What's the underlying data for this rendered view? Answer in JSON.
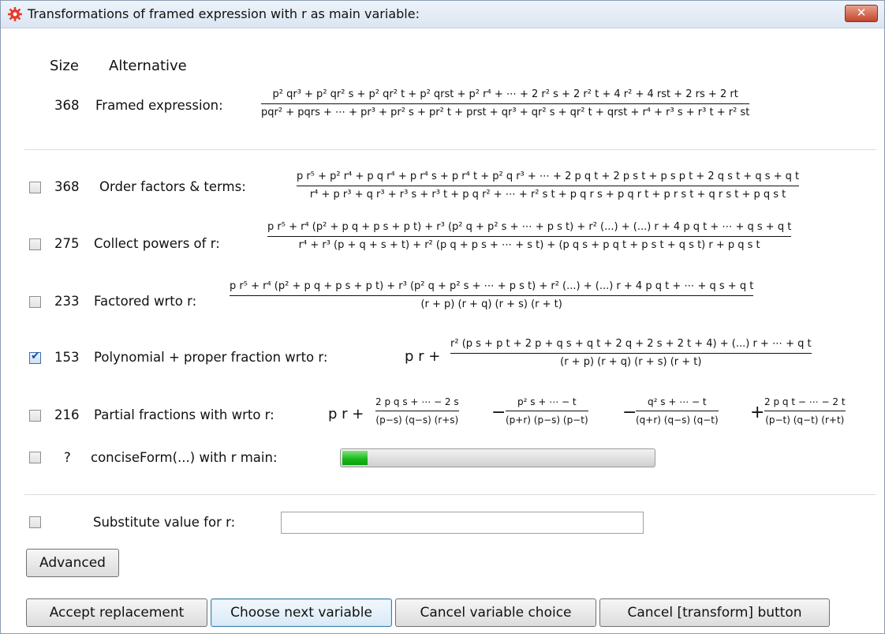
{
  "window": {
    "title": "Transformations of framed expression with r as main variable:",
    "close_label": "✕"
  },
  "header": {
    "size_col": "Size",
    "alt_col": "Alternative"
  },
  "framed": {
    "size": "368",
    "label": "Framed expression:",
    "num": "p² qr³ + p² qr² s + p² qr² t + p² qrst + p² r⁴ + ⋯ + 2 r² s + 2 r² t + 4 r² + 4 rst + 2 rs + 2 rt",
    "den": "pqr² + pqrs + ⋯ + pr³ + pr² s + pr² t + prst + qr³ + qr² s + qr² t + qrst + r⁴ + r³ s + r³ t + r² st"
  },
  "rows": [
    {
      "checked": false,
      "size": "368",
      "label": "Order factors & terms:",
      "num": "p r⁵ + p² r⁴ + p q r⁴ + p r⁴ s + p r⁴ t + p² q r³ + ⋯ + 2 p q t + 2 p s t + p s p t + 2 q s t + q s + q t",
      "den": "r⁴ + p r³ + q r³ + r³ s + r³ t + p q r² + ⋯ + r² s t + p q r s + p q r t + p r s t + q r s t + p q s t"
    },
    {
      "checked": false,
      "size": "275",
      "label": "Collect powers of r:",
      "num": "p r⁵ + r⁴ (p² + p q + p s + p t) + r³ (p² q + p² s + ⋯ + p s t) + r² (...) + (...) r + 4 p q t + ⋯ + q s + q t",
      "den": "r⁴ + r³ (p + q + s + t) + r² (p q + p s + ⋯ + s t) + (p q s + p q t + p s t + q s t) r + p q s t"
    },
    {
      "checked": false,
      "size": "233",
      "label": "Factored wrto r:",
      "num": "p r⁵ + r⁴ (p² + p q + p s + p t) + r³ (p² q + p² s + ⋯ + p s t) + r² (...) + (...) r + 4 p q t + ⋯ + q s + q t",
      "den": "(r + p) (r + q) (r + s) (r + t)"
    },
    {
      "checked": true,
      "size": "153",
      "label": "Polynomial + proper fraction wrto r:",
      "prefix": "p r +",
      "num": "r² (p s + p t + 2 p + q s + q t + 2 q + 2 s + 2 t + 4) + (...) r + ⋯ + q t",
      "den": "(r + p) (r + q) (r + s) (r + t)"
    },
    {
      "checked": false,
      "size": "216",
      "label": "Partial fractions with wrto r:",
      "prefix": "p r +",
      "terms": [
        {
          "op": "",
          "num": "2 p q s + ⋯ − 2 s",
          "den": "(p−s) (q−s) (r+s)"
        },
        {
          "op": "−",
          "num": "p² s + ⋯ − t",
          "den": "(p+r) (p−s) (p−t)"
        },
        {
          "op": "−",
          "num": "q² s + ⋯ − t",
          "den": "(q+r) (q−s) (q−t)"
        },
        {
          "op": "+",
          "num": "2 p q t − ⋯ − 2 t",
          "den": "(p−t) (q−t) (r+t)"
        }
      ]
    },
    {
      "checked": false,
      "size": "?",
      "label": "conciseForm(...) with r main:",
      "progress": 0.08
    }
  ],
  "substitute": {
    "checked": false,
    "label": "Substitute value for r:",
    "value": ""
  },
  "buttons": {
    "advanced": "Advanced",
    "accept": "Accept replacement",
    "next": "Choose next variable",
    "cancel_var": "Cancel variable choice",
    "cancel_transform": "Cancel [transform] button"
  }
}
